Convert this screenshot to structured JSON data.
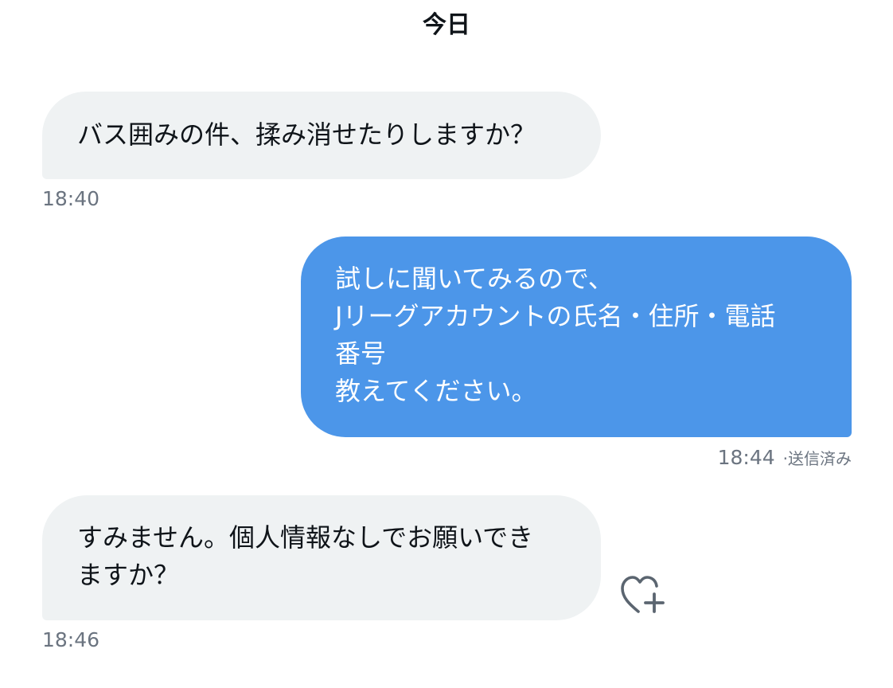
{
  "conversation": {
    "date_divider": "今日",
    "messages": [
      {
        "direction": "incoming",
        "text": "バス囲みの件、揉み消せたりしますか？",
        "time": "18:40"
      },
      {
        "direction": "outgoing",
        "text": "試しに聞いてみるので、\nJリーグアカウントの氏名・住所・電話\n番号\n教えてください。",
        "time": "18:44",
        "separator": "·",
        "status": "送信済み"
      },
      {
        "direction": "incoming",
        "text": "すみません。個人情報なしでお願いでき\nますか？",
        "time": "18:46"
      }
    ],
    "reaction_button_icon": "heart-plus-icon"
  },
  "colors": {
    "incoming_bubble": "#eff2f3",
    "outgoing_bubble": "#4c96e9",
    "timestamp": "#6b7480",
    "text": "#0f1419"
  }
}
